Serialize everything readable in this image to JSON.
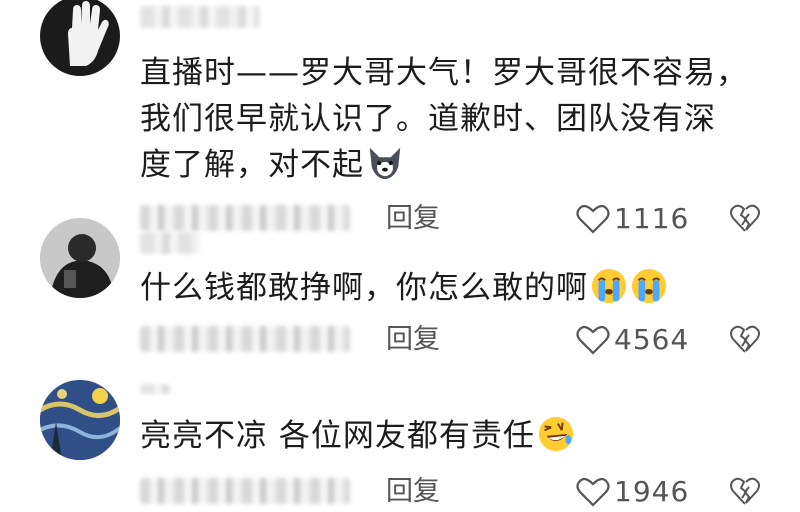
{
  "comments": [
    {
      "avatar_icon": "hand-stop-avatar-icon",
      "text_lines": [
        "直播时——罗大哥大气！罗大哥很不容易，",
        "我们很早就认识了。道歉时、团队没有深",
        "度了解，对不起"
      ],
      "emoji": "husky-dog-emoji",
      "reply_label": "回复",
      "like_count": "1116"
    },
    {
      "avatar_icon": "person-dark-avatar-icon",
      "text_lines": [
        "什么钱都敢挣啊，你怎么敢的啊"
      ],
      "emoji": "crying-face-emoji",
      "reply_label": "回复",
      "like_count": "4564"
    },
    {
      "avatar_icon": "starry-night-avatar-icon",
      "text_lines": [
        "亮亮不凉 各位网友都有责任"
      ],
      "emoji": "rolling-laughing-face-emoji",
      "reply_label": "回复",
      "like_count": "1946"
    }
  ],
  "colors": {
    "text": "#1c1c1c",
    "meta": "#555555",
    "background": "#ffffff"
  }
}
